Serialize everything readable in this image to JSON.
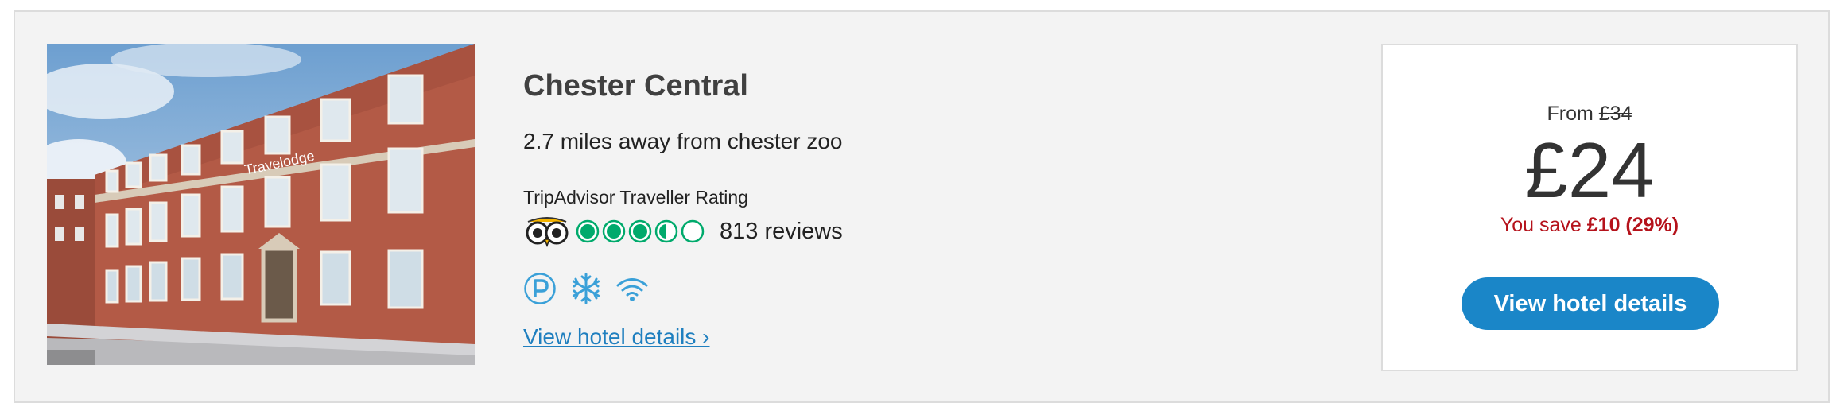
{
  "hotel": {
    "name": "Chester Central",
    "distance": "2.7 miles away from chester zoo",
    "rating_label": "TripAdvisor Traveller Rating",
    "rating": 3.5,
    "rating_max": 5,
    "reviews": "813 reviews",
    "amenities": [
      "parking-icon",
      "air-conditioning-icon",
      "wifi-icon"
    ],
    "details_link": "View hotel details ›",
    "photo_sign": "Travelodge"
  },
  "pricing": {
    "from_label": "From",
    "old_price": "£34",
    "price": "£24",
    "save_label": "You save",
    "save_amount": "£10 (29%)",
    "cta_label": "View hotel details"
  },
  "colors": {
    "accent": "#1a86c8",
    "link": "#1f7fbf",
    "save": "#b5121b",
    "rating_green": "#00aa6c",
    "amenity_blue": "#3aa0d8"
  }
}
